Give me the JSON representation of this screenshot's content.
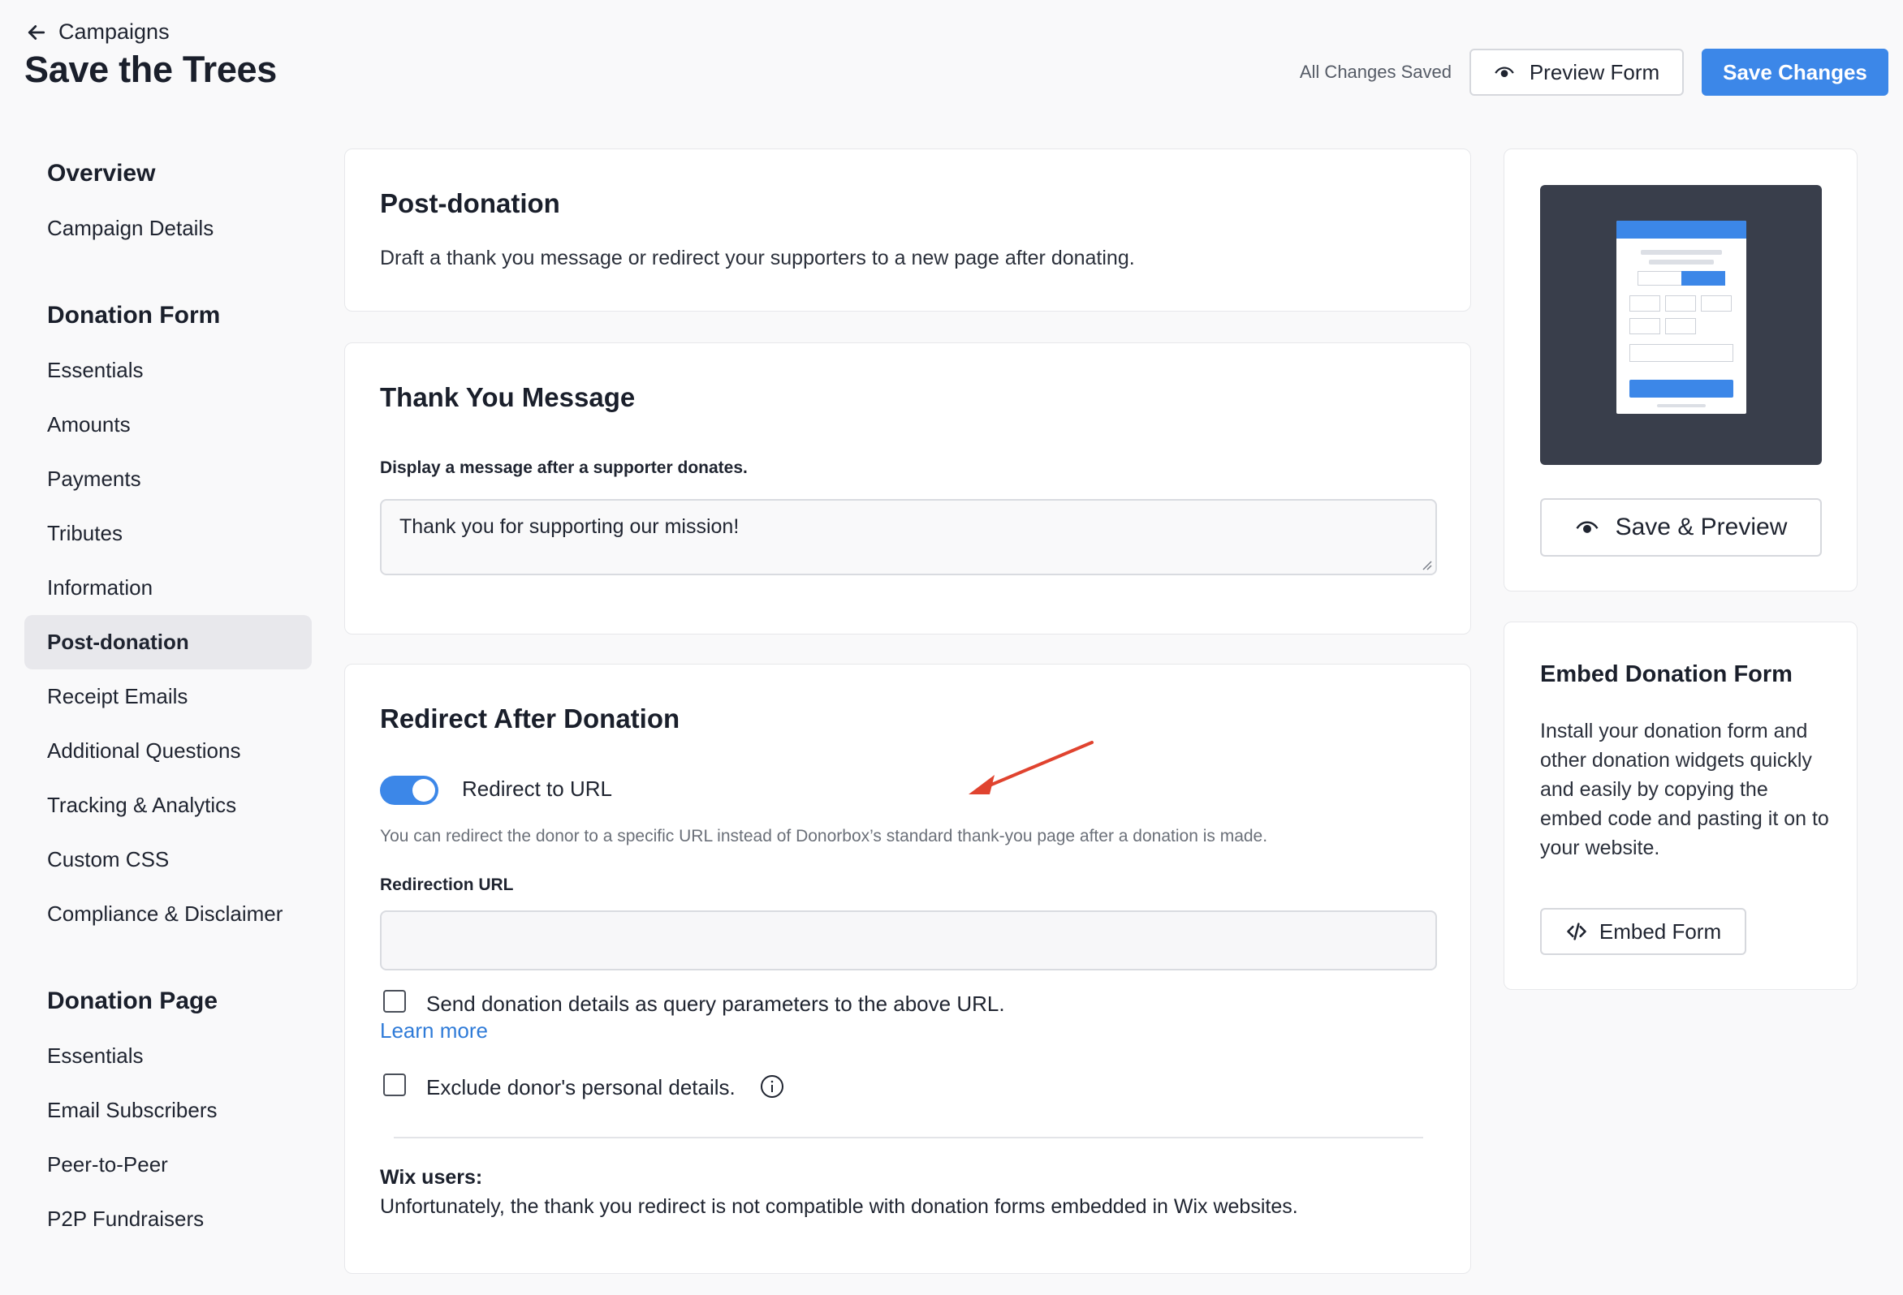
{
  "header": {
    "back_label": "Campaigns",
    "title": "Save the Trees",
    "saved_status": "All Changes Saved",
    "preview_form_label": "Preview Form",
    "save_changes_label": "Save Changes"
  },
  "sidebar": {
    "sections": [
      {
        "heading": "Overview",
        "items": [
          "Campaign Details"
        ]
      },
      {
        "heading": "Donation Form",
        "items": [
          "Essentials",
          "Amounts",
          "Payments",
          "Tributes",
          "Information",
          "Post-donation",
          "Receipt Emails",
          "Additional Questions",
          "Tracking & Analytics",
          "Custom CSS",
          "Compliance & Disclaimer"
        ]
      },
      {
        "heading": "Donation Page",
        "items": [
          "Essentials",
          "Email Subscribers",
          "Peer-to-Peer",
          "P2P Fundraisers"
        ]
      }
    ],
    "active_item": "Post-donation"
  },
  "post_donation": {
    "title": "Post-donation",
    "description": "Draft a thank you message or redirect your supporters to a new page after donating."
  },
  "thank_you": {
    "title": "Thank You Message",
    "label": "Display a message after a supporter donates.",
    "message": "Thank you for supporting our mission!"
  },
  "redirect": {
    "title": "Redirect After Donation",
    "toggle_label": "Redirect to URL",
    "toggle_on": true,
    "help": "You can redirect the donor to a specific URL instead of Donorbox’s standard thank-you page after a donation is made.",
    "url_label": "Redirection URL",
    "url_value": "",
    "query_checkbox_label": "Send donation details as query parameters to the above URL.",
    "learn_more": "Learn more",
    "exclude_checkbox_label": "Exclude donor's personal details.",
    "wix_title": "Wix users:",
    "wix_text": "Unfortunately, the thank you redirect is not compatible with donation forms embedded in Wix websites."
  },
  "preview": {
    "save_preview_label": "Save & Preview"
  },
  "embed": {
    "title": "Embed Donation Form",
    "description": "Install your donation form and other donation widgets quickly and easily by copying the embed code and pasting it on to your website.",
    "button_label": "Embed Form"
  },
  "colors": {
    "accent": "#3c87e8",
    "link": "#2f7bd8",
    "annotation_arrow": "#e0432f",
    "active_bg": "#e8e8ec"
  }
}
